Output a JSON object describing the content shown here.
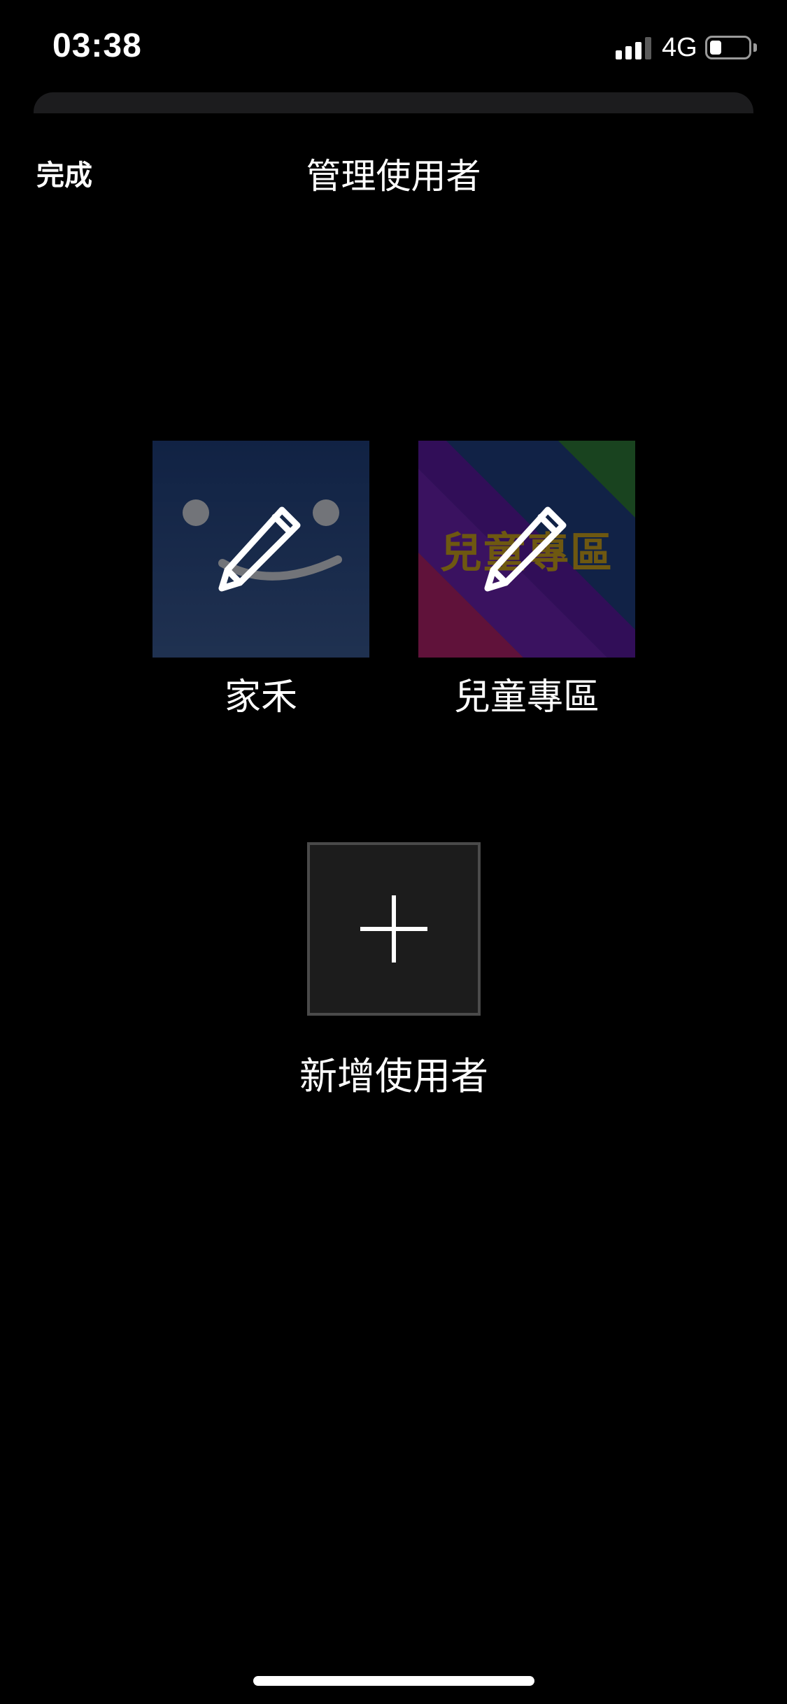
{
  "status_bar": {
    "time": "03:38",
    "network": "4G",
    "signal_bars_active": 3,
    "signal_bars_total": 4,
    "battery_level": 0.3
  },
  "nav": {
    "done_label": "完成",
    "title": "管理使用者"
  },
  "profiles": [
    {
      "name": "家禾",
      "avatar_style": "smiley-blue",
      "icon": "pencil-icon"
    },
    {
      "name": "兒童專區",
      "avatar_style": "kids-rainbow",
      "avatar_text": "兒童專區",
      "icon": "pencil-icon"
    }
  ],
  "add_user": {
    "label": "新增使用者",
    "icon": "plus-icon"
  },
  "colors": {
    "background": "#000000",
    "sheet": "#1c1c1e",
    "avatar_blue": "#1e3f7a",
    "kids_text": "#c8a020",
    "add_border": "#4a4a4a"
  }
}
